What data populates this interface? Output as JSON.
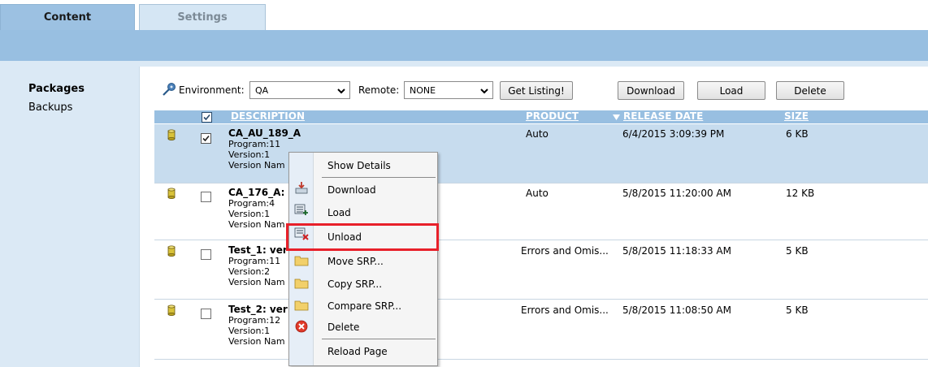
{
  "tabs": {
    "content": "Content",
    "settings": "Settings"
  },
  "sidebar": {
    "items": [
      {
        "label": "Packages"
      },
      {
        "label": "Backups"
      }
    ]
  },
  "toolbar": {
    "environment_label": "Environment:",
    "environment_value": "QA",
    "remote_label": "Remote:",
    "remote_value": "NONE",
    "get_listing": "Get Listing!",
    "download": "Download",
    "load": "Load",
    "delete": "Delete"
  },
  "table": {
    "headers": {
      "description": "DESCRIPTION",
      "product": "PRODUCT",
      "release_date": "RELEASE DATE",
      "size": "SIZE"
    },
    "rows": [
      {
        "title": "CA_AU_189_A",
        "program": "Program:11",
        "version": "Version:1",
        "version_name": "Version Nam",
        "product": "Auto",
        "release_date": "6/4/2015 3:09:39 PM",
        "size": "6 KB",
        "checked": true
      },
      {
        "title": "CA_176_A:",
        "program": "Program:4",
        "version": "Version:1",
        "version_name": "Version Nam",
        "product": "Auto",
        "release_date": "5/8/2015 11:20:00 AM",
        "size": "12 KB",
        "checked": false
      },
      {
        "title": "Test_1: ver",
        "program": "Program:11",
        "version": "Version:2",
        "version_name": "Version Nam",
        "product": "Errors and Omis...",
        "release_date": "5/8/2015 11:18:33 AM",
        "size": "5 KB",
        "checked": false
      },
      {
        "title": "Test_2: ver",
        "program": "Program:12",
        "version": "Version:1",
        "version_name": "Version Nam",
        "product": "Errors and Omis...",
        "release_date": "5/8/2015 11:08:50 AM",
        "size": "5 KB",
        "checked": false
      }
    ]
  },
  "context_menu": {
    "show_details": "Show Details",
    "download": "Download",
    "load": "Load",
    "unload": "Unload",
    "move_srp": "Move SRP...",
    "copy_srp": "Copy SRP...",
    "compare_srp": "Compare SRP...",
    "delete": "Delete",
    "reload_page": "Reload Page"
  },
  "colors": {
    "header_blue": "#98bfe1",
    "sidebar_bg": "#dbe9f5",
    "selected_row": "#c7dcee",
    "highlight_red": "#e8202a"
  }
}
